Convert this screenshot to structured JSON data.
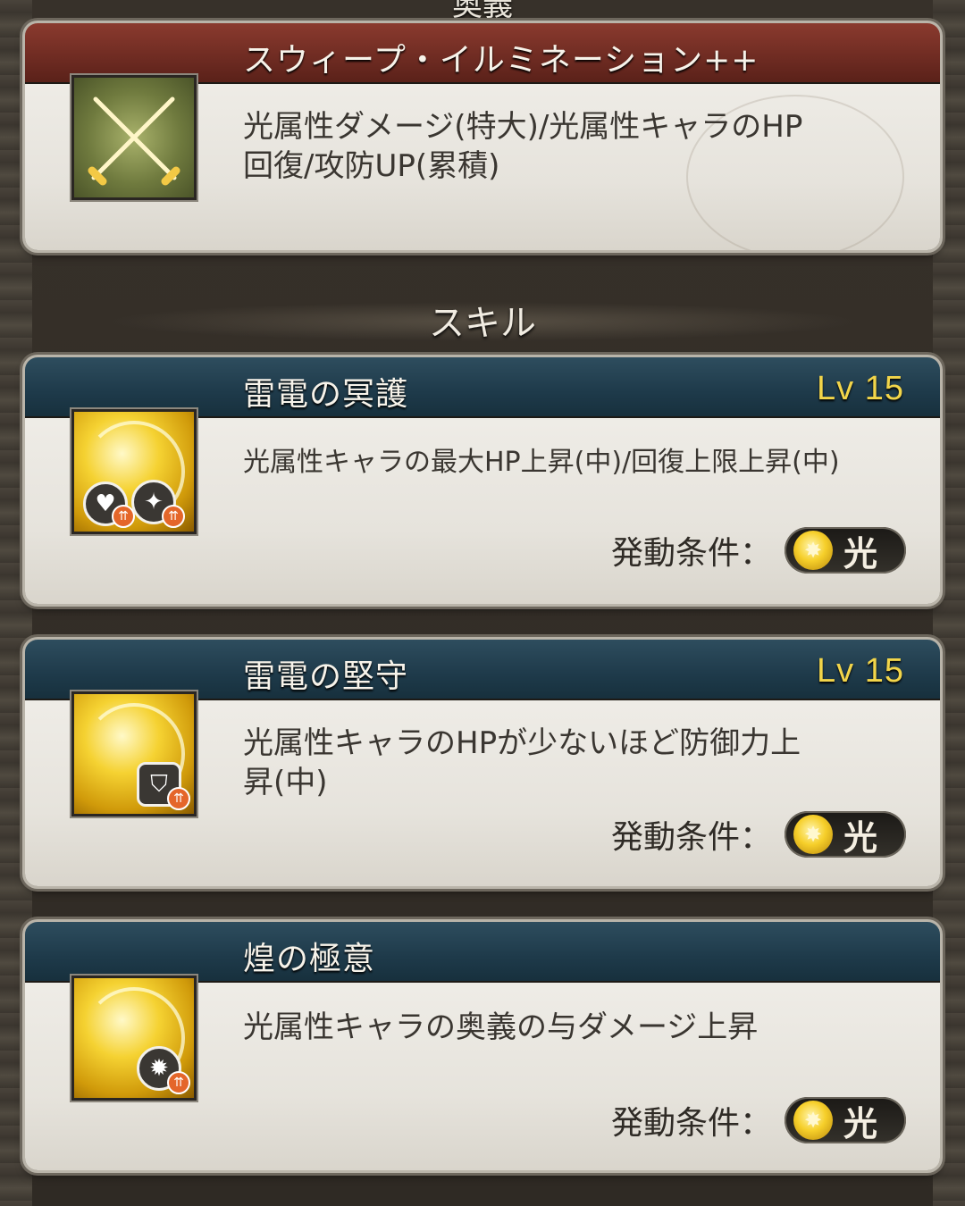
{
  "top_header": "奥義",
  "ougi": {
    "title": "スウィープ・イルミネーション++",
    "icon": "crossed-swords-icon",
    "description_line1": "光属性ダメージ(特大)/光属性キャラのHP",
    "description_line2": "回復/攻防UP(累積)",
    "bar_color": "#7a3227"
  },
  "section_title": "スキル",
  "skills": [
    {
      "title": "雷電の冥護",
      "level": "Lv 15",
      "description_line1": "光属性キャラの最大HP上昇(中)/回復上限上昇(中)",
      "description_line2": "",
      "trigger_label": "発動条件：",
      "trigger_value": "光",
      "icon": "light-orb-hp-heal-up-icon"
    },
    {
      "title": "雷電の堅守",
      "level": "Lv 15",
      "description_line1": "光属性キャラのHPが少ないほど防御力上",
      "description_line2": "昇(中)",
      "trigger_label": "発動条件：",
      "trigger_value": "光",
      "icon": "light-orb-defense-up-icon"
    },
    {
      "title": "煌の極意",
      "level": "",
      "description_line1": "光属性キャラの奥義の与ダメージ上昇",
      "description_line2": "",
      "trigger_label": "発動条件：",
      "trigger_value": "光",
      "icon": "light-orb-ougi-damage-up-icon"
    }
  ],
  "colors": {
    "skill_bar": "#1e3a4a",
    "ougi_bar": "#6e2b22",
    "level_text": "#f2d54a"
  }
}
